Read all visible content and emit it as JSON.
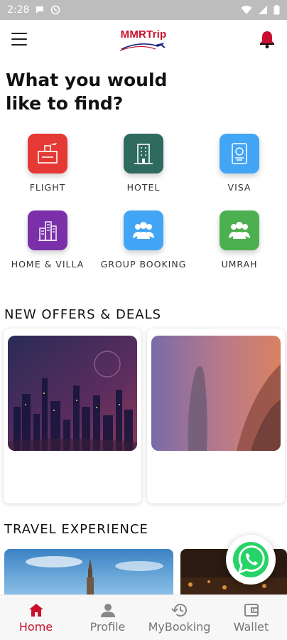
{
  "status_bar": {
    "time": "2:28"
  },
  "app": {
    "logo_text": "MMRTrip"
  },
  "heading": {
    "line1": "What you would",
    "line2": "like to find?"
  },
  "services": [
    {
      "label": "FLIGHT",
      "color": "#e53935",
      "icon": "flight-icon"
    },
    {
      "label": "HOTEL",
      "color": "#2e6b5e",
      "icon": "hotel-icon"
    },
    {
      "label": "VISA",
      "color": "#42a5f5",
      "icon": "passport-icon"
    },
    {
      "label": "HOME & VILLA",
      "color": "#7b2fa8",
      "icon": "villa-icon"
    },
    {
      "label": "GROUP BOOKING",
      "color": "#42a5f5",
      "icon": "group-icon"
    },
    {
      "label": "UMRAH",
      "color": "#4caf50",
      "icon": "group-icon"
    }
  ],
  "sections": {
    "offers_title": "NEW OFFERS & DEALS",
    "travel_title": "TRAVEL EXPERIENCE"
  },
  "bottom_nav": [
    {
      "label": "Home",
      "icon": "home-icon",
      "active": true
    },
    {
      "label": "Profile",
      "icon": "person-icon",
      "active": false
    },
    {
      "label": "MyBooking",
      "icon": "history-icon",
      "active": false
    },
    {
      "label": "Wallet",
      "icon": "wallet-icon",
      "active": false
    }
  ],
  "colors": {
    "brand_red": "#c8102e",
    "whatsapp_green": "#25d366"
  }
}
